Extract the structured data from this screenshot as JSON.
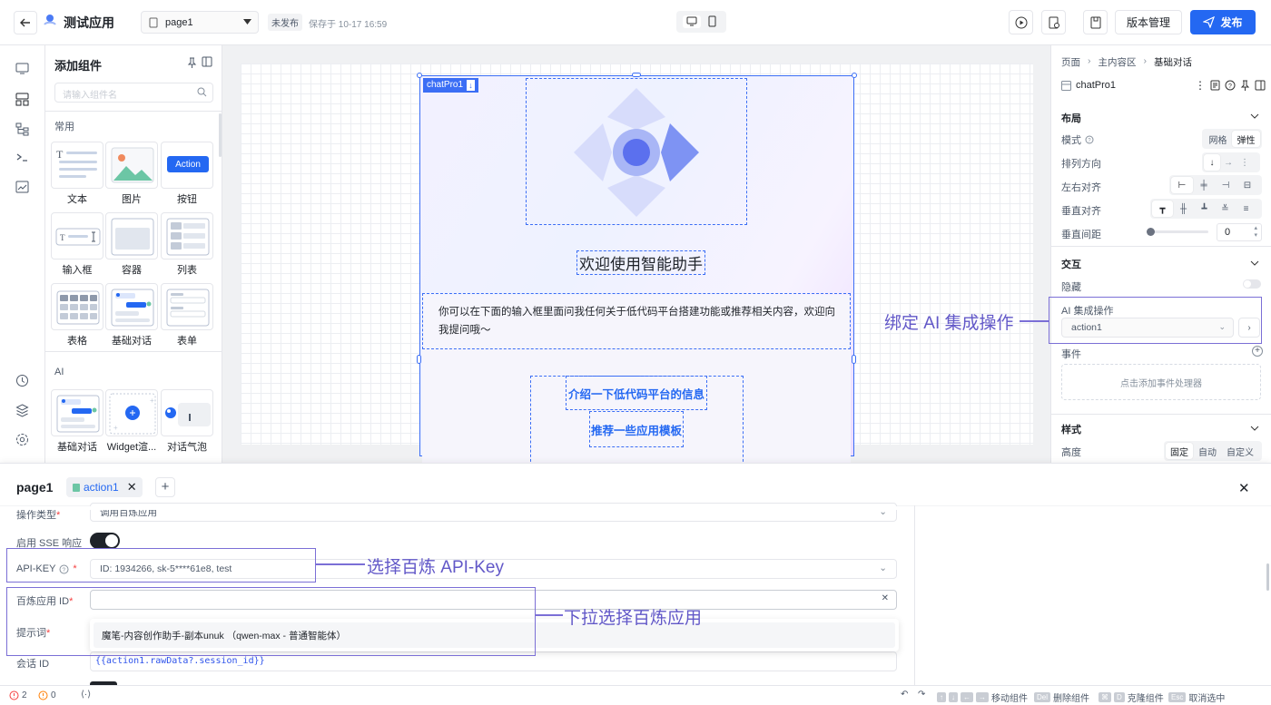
{
  "topbar": {
    "app_title": "测试应用",
    "page_select": "page1",
    "status_badge": "未发布",
    "saved_text": "保存于 10-17 16:59",
    "version_button": "版本管理",
    "publish_button": "发布"
  },
  "components": {
    "title": "添加组件",
    "search_placeholder": "请输入组件名",
    "section_common": "常用",
    "action_chip": "Action",
    "common_items": [
      "文本",
      "图片",
      "按钮",
      "输入框",
      "容器",
      "列表",
      "表格",
      "基础对话",
      "表单"
    ],
    "section_ai": "AI",
    "ai_items": [
      "基础对话",
      "Widget渲...",
      "对话气泡"
    ]
  },
  "canvas": {
    "selected_tag": "chatPro1",
    "welcome_title": "欢迎使用智能助手",
    "welcome_text": "你可以在下面的输入框里面问我任何关于低代码平台搭建功能或推荐相关内容，欢迎向我提问哦～",
    "suggestions": [
      "介绍一下低代码平台的信息",
      "推荐一些应用模板"
    ]
  },
  "props": {
    "breadcrumb": [
      "页面",
      "主内容区",
      "基础对话"
    ],
    "component_name": "chatPro1",
    "layout_title": "布局",
    "mode_label": "模式",
    "mode_options": [
      "网格",
      "弹性"
    ],
    "direction_label": "排列方向",
    "h_align_label": "左右对齐",
    "v_align_label": "垂直对齐",
    "v_gap_label": "垂直间距",
    "v_gap_value": "0",
    "interaction_title": "交互",
    "hidden_label": "隐藏",
    "ai_action_label": "AI 集成操作",
    "ai_action_value": "action1",
    "events_label": "事件",
    "add_event_handler": "点击添加事件处理器",
    "style_title": "样式",
    "height_label": "高度",
    "height_options": [
      "固定",
      "自动",
      "自定义"
    ]
  },
  "annotations": {
    "bind_ai": "绑定 AI 集成操作",
    "select_apikey": "选择百炼 API-Key",
    "select_app": "下拉选择百炼应用"
  },
  "bottom": {
    "page_title": "page1",
    "tab_label": "action1",
    "op_type_label": "操作类型",
    "op_type_value": "调用百炼应用",
    "sse_label": "启用 SSE 响应",
    "apikey_label": "API-KEY",
    "apikey_value": "ID: 1934266, sk-5****61e8, test",
    "app_id_label": "百炼应用 ID",
    "prompt_label": "提示词",
    "dropdown_option": "魔笔-内容创作助手-副本unuk （qwen-max - 普通智能体）",
    "session_label": "会话 ID",
    "session_value": "{{action1.rawData?.session_id}}"
  },
  "statusbar": {
    "errors": "2",
    "warnings": "0",
    "hints": [
      "移动组件",
      "删除组件",
      "克隆组件",
      "取消选中"
    ],
    "keys": [
      "Del",
      "D",
      "Esc"
    ]
  },
  "colors": {
    "primary": "#2468f2",
    "annotation": "#6258c8",
    "selected": "#3b6ef5"
  }
}
